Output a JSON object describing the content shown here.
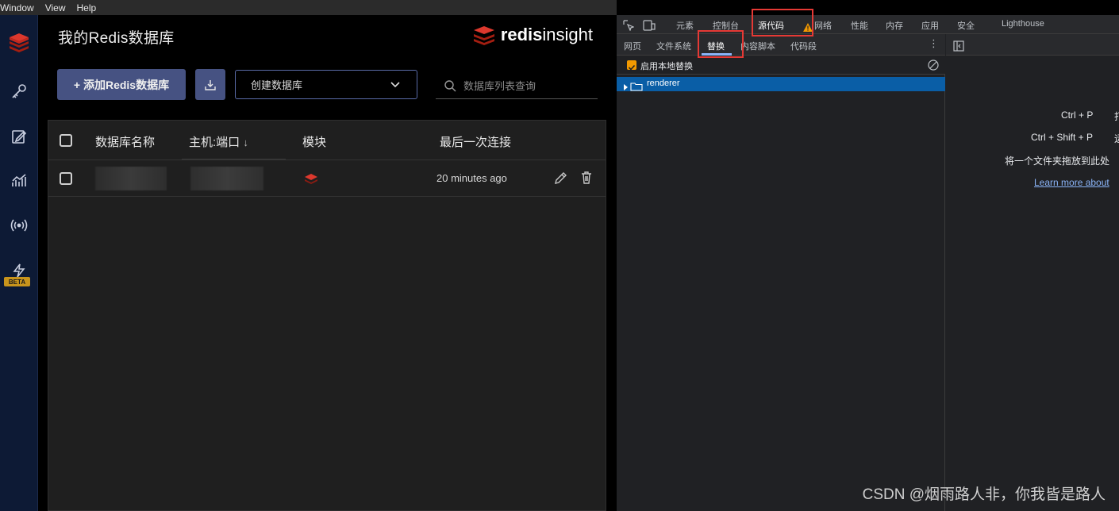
{
  "menubar": {
    "items": [
      "Window",
      "View",
      "Help"
    ]
  },
  "nav": {
    "icons": [
      "redis-logo-icon",
      "key-icon",
      "workbench-icon",
      "analytics-icon",
      "pubsub-icon",
      "triggers-icon"
    ],
    "beta_label": "BETA"
  },
  "header": {
    "title": "我的Redis数据库",
    "brand_bold": "redis",
    "brand_light": "insight"
  },
  "toolbar": {
    "add_label": "+ 添加Redis数据库",
    "create_select": "创建数据库",
    "search_placeholder": "数据库列表查询"
  },
  "table": {
    "columns": [
      "数据库名称",
      "主机:端口",
      "模块",
      "最后一次连接"
    ],
    "sort_indicator": "↓",
    "rows": [
      {
        "name": "",
        "host": "",
        "last_connected": "20 minutes ago"
      }
    ]
  },
  "devtools": {
    "tabs": [
      "元素",
      "控制台",
      "源代码",
      "网络",
      "性能",
      "内存",
      "应用",
      "安全",
      "Lighthouse"
    ],
    "active_tab": "源代码",
    "subtabs": [
      "网页",
      "文件系统",
      "替换",
      "内容脚本",
      "代码段"
    ],
    "active_subtab": "替换",
    "enable_overrides": "启用本地替换",
    "tree_item": "renderer",
    "hints": {
      "ctrl_p": "Ctrl + P",
      "ctrl_p_action": "打",
      "ctrl_shift_p": "Ctrl + Shift + P",
      "ctrl_shift_p_action": "运",
      "drop_folder": "将一个文件夹拖放到此处",
      "learn_more": "Learn more about"
    }
  },
  "colors": {
    "accent": "#465282",
    "devtools_bg": "#202124",
    "highlight_box": "#e53935",
    "selected_row": "#0a5ea6"
  },
  "watermark": "CSDN @烟雨路人非，你我皆是路人"
}
